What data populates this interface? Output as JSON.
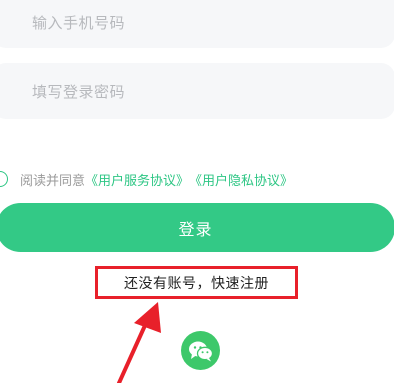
{
  "login_form": {
    "phone_placeholder": "输入手机号码",
    "password_placeholder": "填写登录密码",
    "agreement_prefix": "阅读并同意",
    "user_agreement_link": "《用户服务协议》",
    "privacy_policy_link": "《用户隐私协议》",
    "login_button": "登录",
    "register_link": "还没有账号，快速注册",
    "wechat_login_icon": "wechat-icon"
  },
  "colors": {
    "accent": "#33c986",
    "link": "#2dc684",
    "annotation": "#e8202a"
  }
}
